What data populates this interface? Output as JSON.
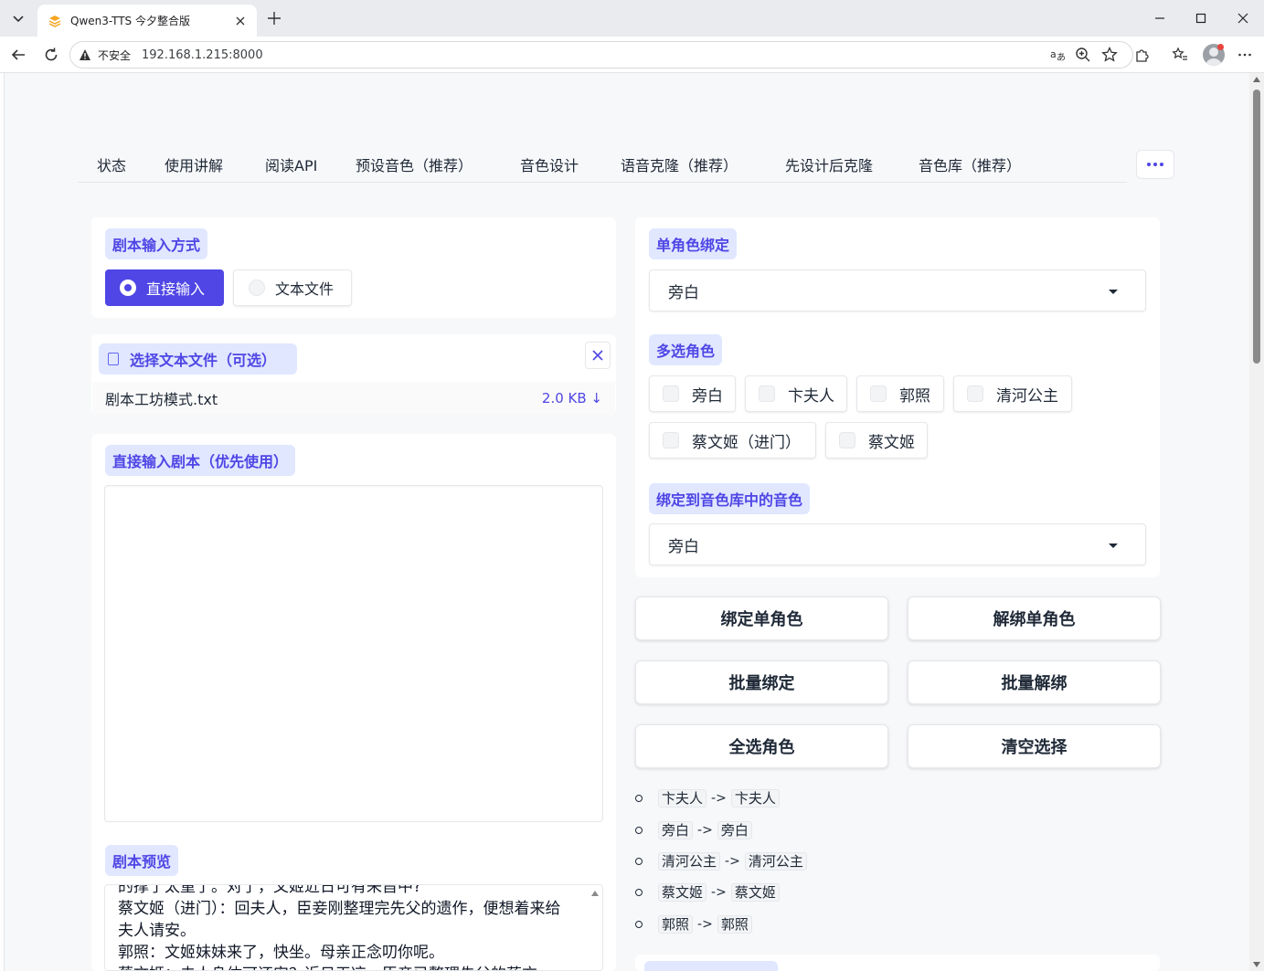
{
  "browser": {
    "tab_title": "Qwen3-TTS 今夕整合版",
    "not_secure": "不安全",
    "url": "192.168.1.215:8000"
  },
  "app_tabs": [
    "状态",
    "使用讲解",
    "阅读API",
    "预设音色（推荐）",
    "音色设计",
    "语音克隆（推荐）",
    "先设计后克隆",
    "音色库（推荐）"
  ],
  "left": {
    "input_mode_label": "剧本输入方式",
    "radio_direct": "直接输入",
    "radio_file": "文本文件",
    "file_chip": "选择文本文件（可选）",
    "file_name": "剧本工坊模式.txt",
    "file_size": "2.0 KB ↓",
    "direct_input_label": "直接输入剧本（优先使用）",
    "preview_label": "剧本预览",
    "preview_lines": [
      "的撑了太重了。对了，文姬近日可有来旨中?",
      "蔡文姬（进门）：回夫人，臣妾刚整理完先父的遗作，便想着来给",
      "夫人请安。",
      "郭照：文姬妹妹来了，快坐。母亲正念叨你呢。",
      "蔡文姬：夫人身体可还安？近日天凉，臣妾已整理先父的药方"
    ]
  },
  "right": {
    "single_bind_label": "单角色绑定",
    "single_bind_value": "旁白",
    "multi_select_label": "多选角色",
    "roles": [
      "旁白",
      "卞夫人",
      "郭照",
      "清河公主",
      "蔡文姬（进门）",
      "蔡文姬"
    ],
    "bind_voice_label": "绑定到音色库中的音色",
    "bind_voice_value": "旁白",
    "buttons": {
      "bind_single": "绑定单角色",
      "unbind_single": "解绑单角色",
      "bind_batch": "批量绑定",
      "unbind_batch": "批量解绑",
      "select_all": "全选角色",
      "clear_select": "清空选择"
    },
    "mappings": [
      {
        "from": "卞夫人",
        "arrow": "->",
        "to": "卞夫人"
      },
      {
        "from": "旁白",
        "arrow": "->",
        "to": "旁白"
      },
      {
        "from": "清河公主",
        "arrow": "->",
        "to": "清河公主"
      },
      {
        "from": "蔡文姬",
        "arrow": "->",
        "to": "蔡文姬"
      },
      {
        "from": "郭照",
        "arrow": "->",
        "to": "郭照"
      }
    ]
  },
  "colors": {
    "accent": "#4f46e5",
    "chip_bg": "#e0e7ff",
    "page_bg": "#f7f8fa"
  }
}
